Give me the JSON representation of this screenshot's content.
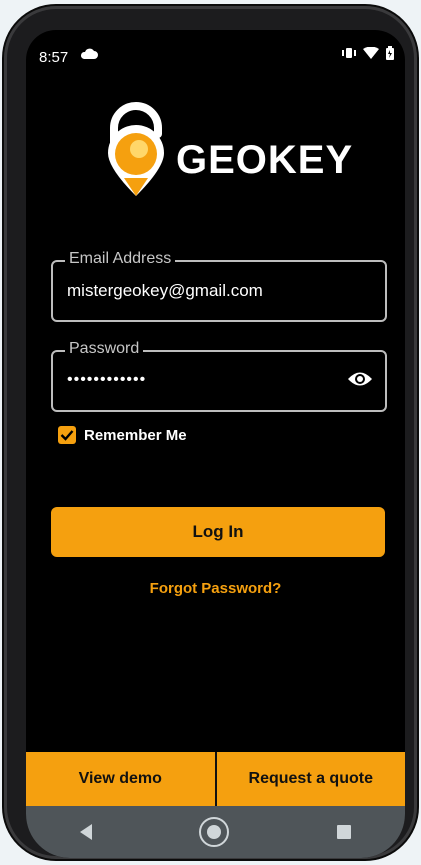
{
  "status": {
    "time": "8:57",
    "icons": [
      "cloud-icon",
      "vibrate-icon",
      "wifi-icon",
      "battery-icon"
    ]
  },
  "brand": {
    "logo_text": "GEOKEY",
    "colors": {
      "accent": "#f5a00f",
      "background": "#000000",
      "nav": "#4f5559"
    }
  },
  "form": {
    "email": {
      "label": "Email Address",
      "value": "mistergeokey@gmail.com"
    },
    "password": {
      "label": "Password",
      "value": "••••••••••••"
    },
    "remember": {
      "label": "Remember Me",
      "checked": true
    },
    "login_label": "Log In",
    "forgot_label": "Forgot Password?"
  },
  "bottom": {
    "demo_label": "View demo",
    "quote_label": "Request a quote"
  },
  "navbar": {
    "items": [
      "back-icon",
      "home-icon",
      "recents-icon"
    ]
  }
}
